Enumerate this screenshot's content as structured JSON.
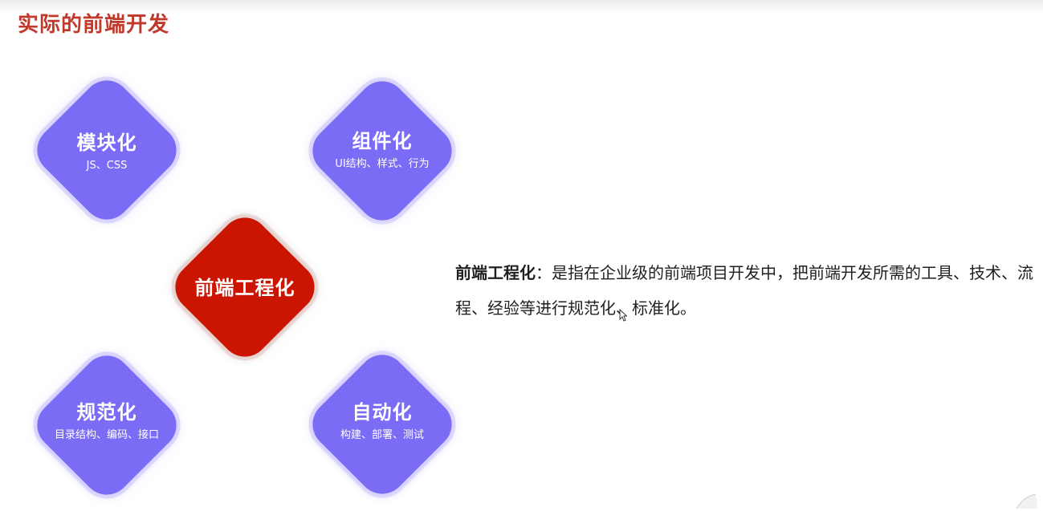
{
  "slide": {
    "title": "实际的前端开发",
    "colors": {
      "title": "#c0392b",
      "diamond": "#7b6cf6",
      "center": "#cc1500"
    }
  },
  "diamonds": {
    "modular": {
      "title": "模块化",
      "subtitle": "JS、CSS"
    },
    "component": {
      "title": "组件化",
      "subtitle": "UI结构、样式、行为"
    },
    "center": {
      "title": "前端工程化"
    },
    "standard": {
      "title": "规范化",
      "subtitle": "目录结构、编码、接口"
    },
    "automation": {
      "title": "自动化",
      "subtitle": "构建、部署、测试"
    }
  },
  "description": {
    "term": "前端工程化",
    "text": "：是指在企业级的前端项目开发中，把前端开发所需的工具、技术、流程、经验等进行规范化、标准化。"
  },
  "icons": {
    "cursor": "mouse-pointer-icon"
  }
}
